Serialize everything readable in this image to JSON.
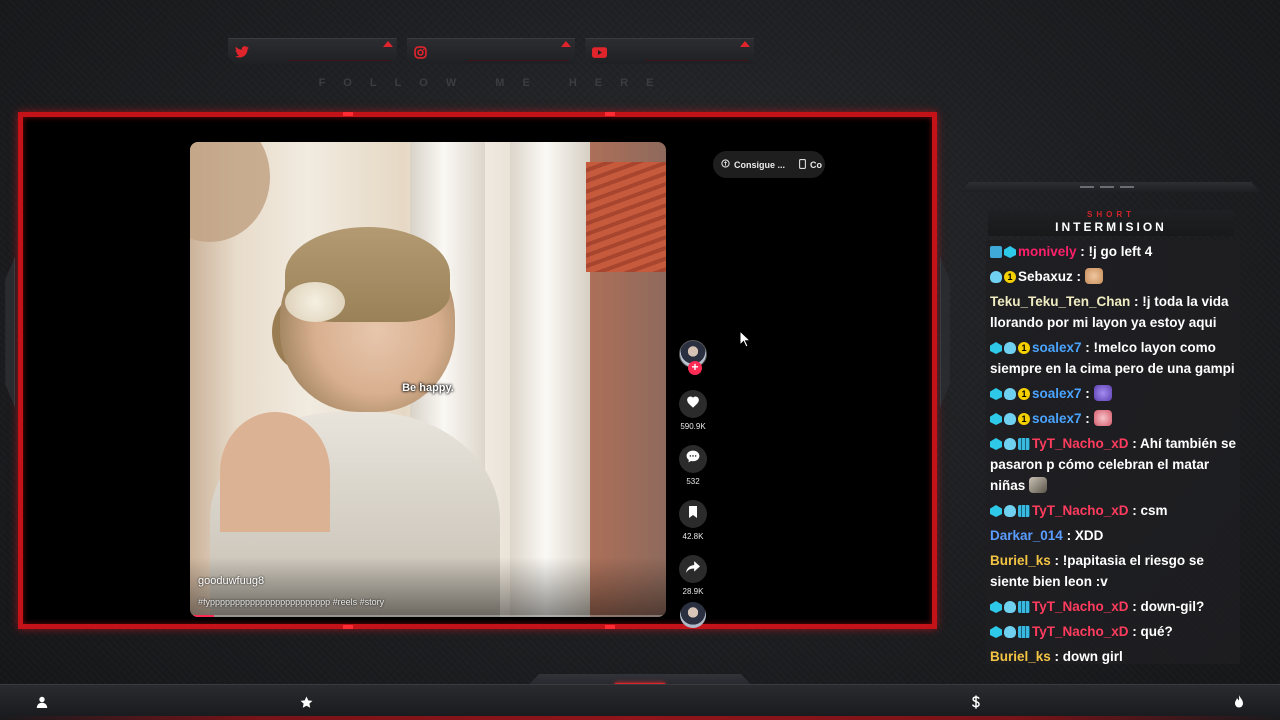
{
  "overlay": {
    "follow_text": "FOLLOW ME HERE",
    "social": [
      {
        "icon": "twitter-icon",
        "color": "#e0242b"
      },
      {
        "icon": "instagram-icon",
        "color": "#e0242b"
      },
      {
        "icon": "youtube-icon",
        "color": "#e0242b"
      }
    ],
    "accent_color": "#c41219"
  },
  "video": {
    "subtitle": "Be happy.",
    "username": "gooduwfuug8",
    "tags": "#fypppppppppppppppppppppppp #reels #story",
    "progress": 0.05,
    "pills": [
      {
        "icon": "coin-icon",
        "label": "Consigue ..."
      },
      {
        "icon": "phone-icon",
        "label": "Co"
      }
    ],
    "actions": [
      {
        "icon": "heart-icon",
        "count": "590.9K"
      },
      {
        "icon": "comment-icon",
        "count": "532"
      },
      {
        "icon": "bookmark-icon",
        "count": "42.8K"
      },
      {
        "icon": "share-icon",
        "count": "28.9K"
      }
    ]
  },
  "chat": {
    "header_small": "SHORT",
    "header_big": "INTERMISION",
    "messages": [
      {
        "user": "monively",
        "text": "!j go left 4"
      },
      {
        "user": "Sebaxuz",
        "text": ""
      },
      {
        "user": "Teku_Teku_Ten_Chan",
        "text": "!j toda la vida llorando por mi layon ya estoy aqui"
      },
      {
        "user": "soalex7",
        "text": "!melco layon como siempre en la cima pero de una gampi"
      },
      {
        "user": "soalex7",
        "text": ""
      },
      {
        "user": "soalex7",
        "text": ""
      },
      {
        "user": "TyT_Nacho_xD",
        "text": "Ahí también se pasaron p cómo celebran el matar niñas"
      },
      {
        "user": "TyT_Nacho_xD",
        "text": "csm"
      },
      {
        "user": "Darkar_014",
        "text": "XDD"
      },
      {
        "user": "Buriel_ks",
        "text": "!papitasia el riesgo se siente bien leon :v"
      },
      {
        "user": "TyT_Nacho_xD",
        "text": "down-gil?"
      },
      {
        "user": "TyT_Nacho_xD",
        "text": "qué?"
      },
      {
        "user": "Buriel_ks",
        "text": "down girl"
      }
    ]
  },
  "bottom_bar": {
    "icons": [
      "user-icon",
      "star-icon",
      "dollar-icon",
      "flame-icon"
    ]
  }
}
